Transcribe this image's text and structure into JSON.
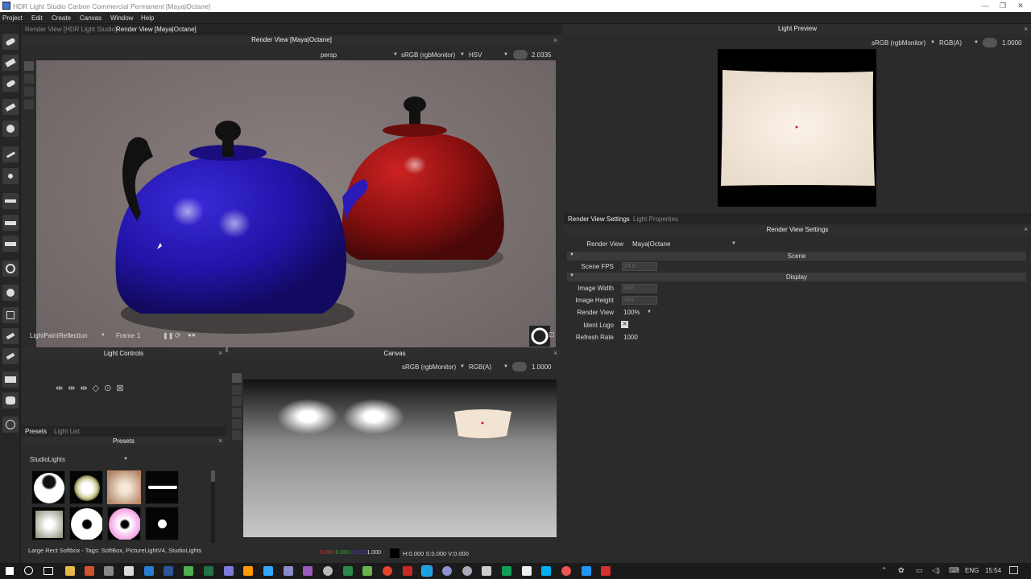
{
  "window": {
    "title": "HDR Light Studio Carbon Commercial Permanent [Maya|Octane]",
    "controls": [
      "—",
      "❐",
      "✕"
    ]
  },
  "menu": [
    "Project",
    "Edit",
    "Create",
    "Canvas",
    "Window",
    "Help"
  ],
  "render_view": {
    "tabs": [
      "Render View [HDR Light Studio]",
      "Render View [Maya|Octane]"
    ],
    "header": "Render View [Maya|Octane]",
    "camera": "persp",
    "colorspace": "sRGB (rgbMonitor)",
    "mode": "HSV",
    "exposure": "2.0335",
    "lightpaint_label": "LightPaint",
    "lightpaint_mode": "Reflection",
    "frame_label": "Frame",
    "frame_value": "1"
  },
  "light_controls": {
    "header": "Light Controls"
  },
  "presets": {
    "tabs": [
      "Presets",
      "Light List"
    ],
    "header": "Presets",
    "category": "StudioLights",
    "status": "Large Rect Softbox - Tags: SoftBox, PictureLightV4, StudioLights"
  },
  "canvas": {
    "header": "Canvas",
    "colorspace": "sRGB (rgbMonitor)",
    "mode": "RGB(A)",
    "exposure": "1.0000",
    "readout_r": "0.000",
    "readout_g": "0.000",
    "readout_b": "0.000",
    "readout_a": "1.000",
    "readout_hsv": "H:0.000 S:0.000 V:0.000"
  },
  "light_preview": {
    "header": "Light Preview",
    "colorspace": "sRGB (rgbMonitor)",
    "mode": "RGB(A)",
    "exposure": "1.0000"
  },
  "render_settings": {
    "tabs": [
      "Render View Settings",
      "Light Properties"
    ],
    "header": "Render View Settings",
    "render_view_label": "Render View",
    "render_view_value": "Maya|Octane",
    "scene_section": "Scene",
    "scene_fps_label": "Scene FPS",
    "scene_fps_value": "24.0",
    "display_section": "Display",
    "image_width_label": "Image Width",
    "image_width_value": "900",
    "image_height_label": "Image Height",
    "image_height_value": "499",
    "render_view_pct_label": "Render View",
    "render_view_pct_value": "100%",
    "ident_logo_label": "Ident Logo",
    "ident_logo_checked": "✕",
    "refresh_rate_label": "Refresh Rate",
    "refresh_rate_value": "1000"
  },
  "taskbar": {
    "lang": "ENG",
    "time": "15:54"
  }
}
